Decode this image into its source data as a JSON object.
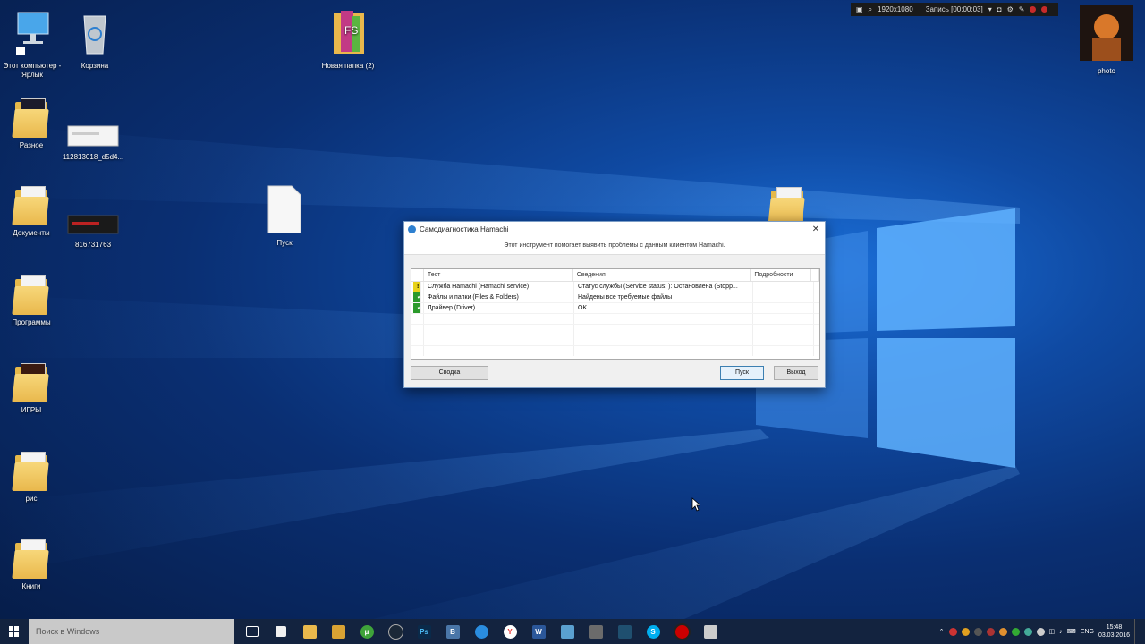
{
  "desktop": {
    "icons": [
      {
        "label": "Этот компьютер - Ярлык",
        "icon": "computer-icon"
      },
      {
        "label": "Корзина",
        "icon": "recycle-bin-icon"
      },
      {
        "label": "Новая папка (2)",
        "icon": "folder-icon"
      },
      {
        "label": "photo",
        "icon": "photo-icon"
      },
      {
        "label": "Разное",
        "icon": "folder-icon"
      },
      {
        "label": "112813018_d5d4...",
        "icon": "image-file-icon"
      },
      {
        "label": "Документы",
        "icon": "folder-icon"
      },
      {
        "label": "816731763",
        "icon": "image-file-icon"
      },
      {
        "label": "Пуск",
        "icon": "file-icon"
      },
      {
        "label": "Программы",
        "icon": "folder-icon"
      },
      {
        "label": "ИГРЫ",
        "icon": "folder-icon"
      },
      {
        "label": "рис",
        "icon": "folder-icon"
      },
      {
        "label": "Книги",
        "icon": "folder-icon"
      }
    ]
  },
  "recorder": {
    "resolution": "1920x1080",
    "status": "Запись [00:00:03]"
  },
  "dialog": {
    "title": "Самодиагностика Hamachi",
    "header_text": "Этот инструмент помогает выявить проблемы с данным клиентом Hamachi.",
    "columns": [
      "Тест",
      "Сведения",
      "Подробности"
    ],
    "rows": [
      {
        "status": "warning",
        "test": "Служба Hamachi (Hamachi service)",
        "info": "Статус службы (Service status: ): Остановлена (Stopp...",
        "details": ""
      },
      {
        "status": "ok",
        "test": "Файлы и папки (Files & Folders)",
        "info": "Найдены все требуемые файлы",
        "details": ""
      },
      {
        "status": "ok",
        "test": "Драйвер (Driver)",
        "info": "OK",
        "details": ""
      }
    ],
    "buttons": {
      "summary": "Сводка",
      "start": "Пуск",
      "exit": "Выход"
    },
    "close_glyph": "✕"
  },
  "taskbar": {
    "search_placeholder": "Поиск в Windows",
    "language": "ENG",
    "time": "15:48",
    "date": "03.03.2016",
    "apps": [
      "task-view",
      "store",
      "explorer",
      "media",
      "utorrent",
      "steam",
      "photoshop",
      "vk",
      "chrome",
      "yandex",
      "word",
      "notepad",
      "app",
      "app",
      "skype",
      "record",
      "app"
    ]
  }
}
